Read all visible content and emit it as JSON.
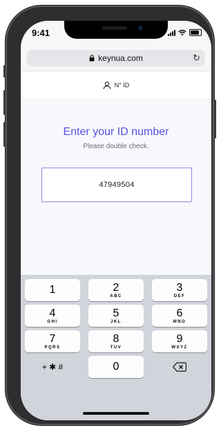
{
  "status_bar": {
    "time": "9:41"
  },
  "browser": {
    "url": "keynua.com"
  },
  "header": {
    "label": "N° ID"
  },
  "main": {
    "title": "Enter your ID number",
    "subtitle": "Please double check.",
    "id_value": "47949504"
  },
  "keypad": {
    "keys": [
      {
        "num": "1",
        "letters": ""
      },
      {
        "num": "2",
        "letters": "ABC"
      },
      {
        "num": "3",
        "letters": "DEF"
      },
      {
        "num": "4",
        "letters": "GHI"
      },
      {
        "num": "5",
        "letters": "JKL"
      },
      {
        "num": "6",
        "letters": "MNO"
      },
      {
        "num": "7",
        "letters": "PQRS"
      },
      {
        "num": "8",
        "letters": "TUV"
      },
      {
        "num": "9",
        "letters": "WXYZ"
      }
    ],
    "symbols": "+ ✱ #",
    "zero": "0",
    "delete_icon": "backspace-icon"
  },
  "colors": {
    "accent": "#5a4fe0",
    "input_border": "#8f86e8",
    "keyboard_bg": "#d1d4da"
  }
}
